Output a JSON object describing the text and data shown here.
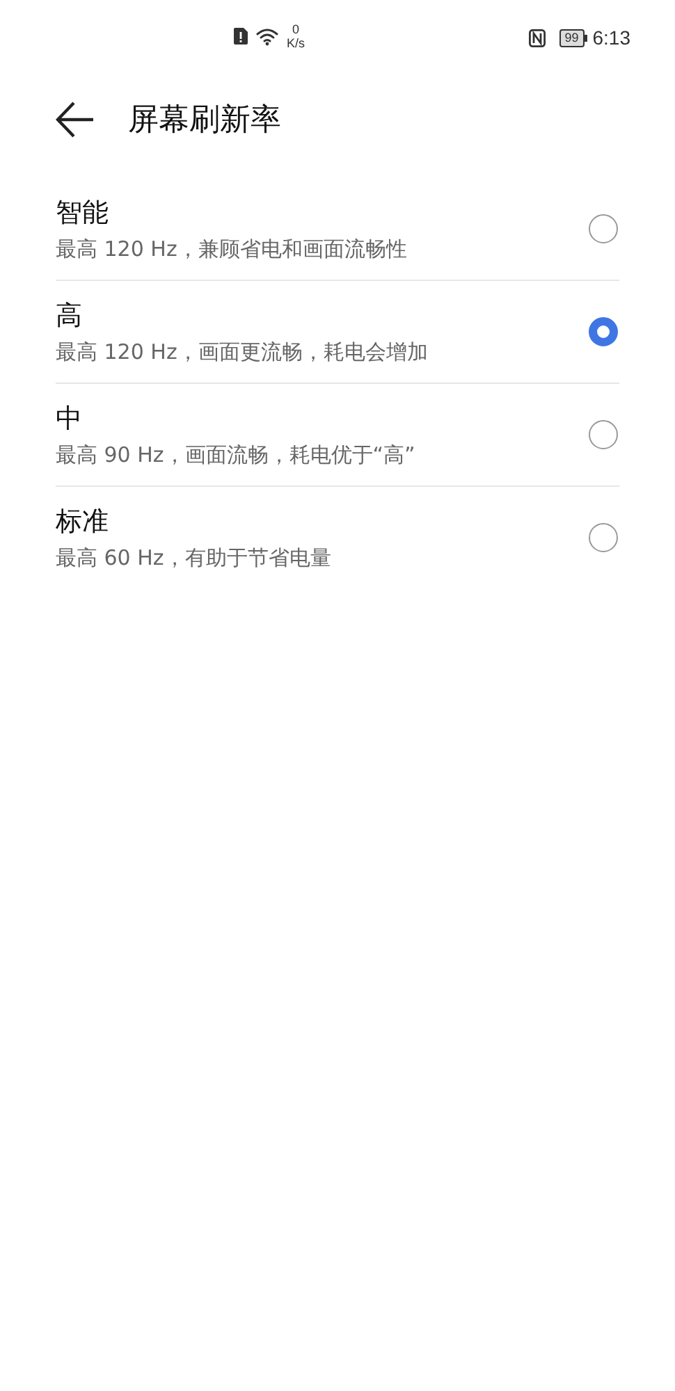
{
  "status_bar": {
    "speed_value": "0",
    "speed_unit": "K/s",
    "battery": "99",
    "time": "6:13"
  },
  "header": {
    "title": "屏幕刷新率"
  },
  "options": [
    {
      "title": "智能",
      "description": "最高 120 Hz，兼顾省电和画面流畅性",
      "selected": false
    },
    {
      "title": "高",
      "description": "最高 120 Hz，画面更流畅，耗电会增加",
      "selected": true
    },
    {
      "title": "中",
      "description": "最高 90 Hz，画面流畅，耗电优于“高”",
      "selected": false
    },
    {
      "title": "标准",
      "description": "最高 60 Hz，有助于节省电量",
      "selected": false
    }
  ]
}
